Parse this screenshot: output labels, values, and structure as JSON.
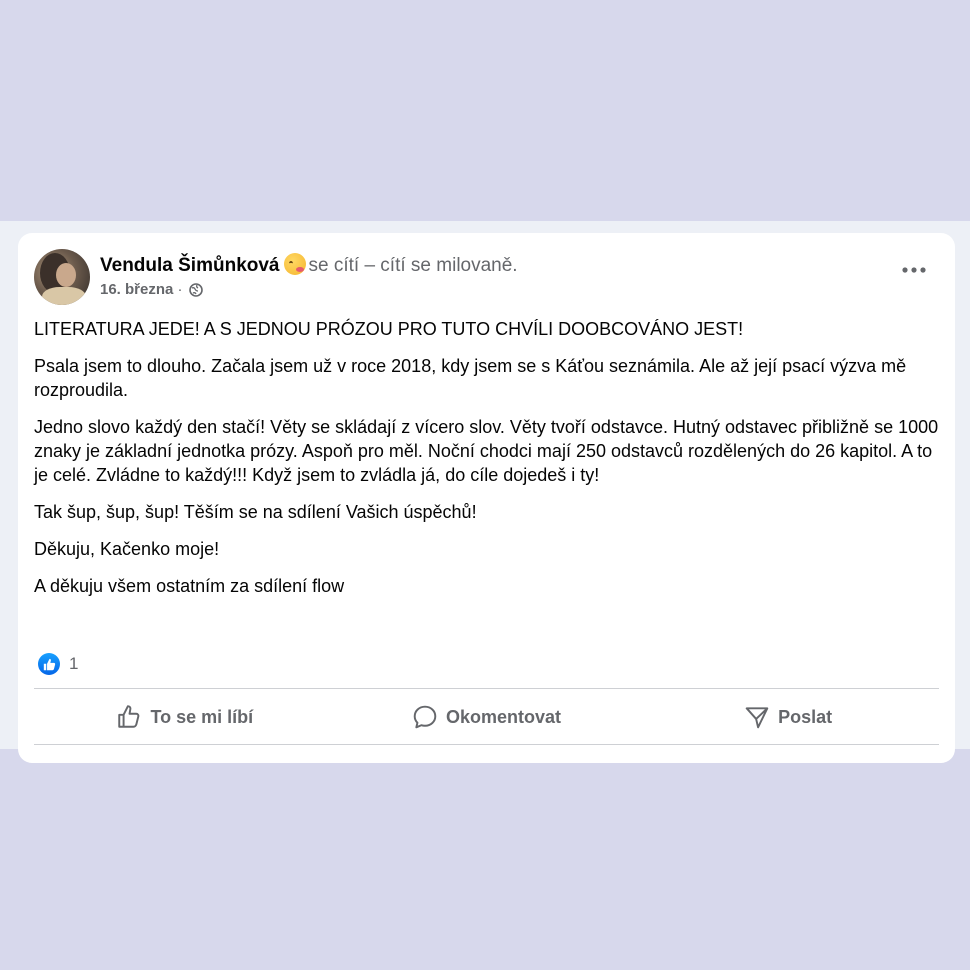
{
  "post": {
    "author": "Vendula Šimůnková",
    "feeling": "se cítí – cítí se milovaně.",
    "date": "16. března",
    "separator": "·",
    "paragraphs": [
      "LITERATURA JEDE! A S JEDNOU PRÓZOU PRO TUTO CHVÍLI DOOBCOVÁNO JEST!",
      "Psala jsem to dlouho. Začala jsem už v roce 2018, kdy jsem se s Káťou seznámila. Ale až její psací výzva mě rozproudila.",
      "Jedno slovo každý den stačí! Věty se skládají z vícero slov. Věty tvoří odstavce. Hutný odstavec přibližně se 1000 znaky je základní jednotka prózy. Aspoň pro měl. Noční chodci mají 250 odstavců rozdělených do 26 kapitol. A to je celé. Zvládne to každý!!! Když jsem to zvládla já, do cíle dojedeš i ty!",
      "Tak šup, šup, šup! Těším se na sdílení Vašich úspěchů!",
      "Děkuju, Kačenko moje!",
      "A děkuju všem ostatním za sdílení flow"
    ],
    "reaction_count": "1"
  },
  "actions": {
    "like": "To se mi líbí",
    "comment": "Okomentovat",
    "share": "Poslat"
  },
  "icons": {
    "privacy": "globe-icon",
    "menu": "more-options-icon",
    "reaction": "like-reaction-icon",
    "like": "thumbs-up-icon",
    "comment": "comment-bubble-icon",
    "share": "send-icon",
    "feeling": "smiling-face-with-hearts-emoji"
  },
  "colors": {
    "page_background": "#d7d8ec",
    "card_background": "#ffffff",
    "secondary_text": "#65676b",
    "like_blue": "#0866ff"
  }
}
